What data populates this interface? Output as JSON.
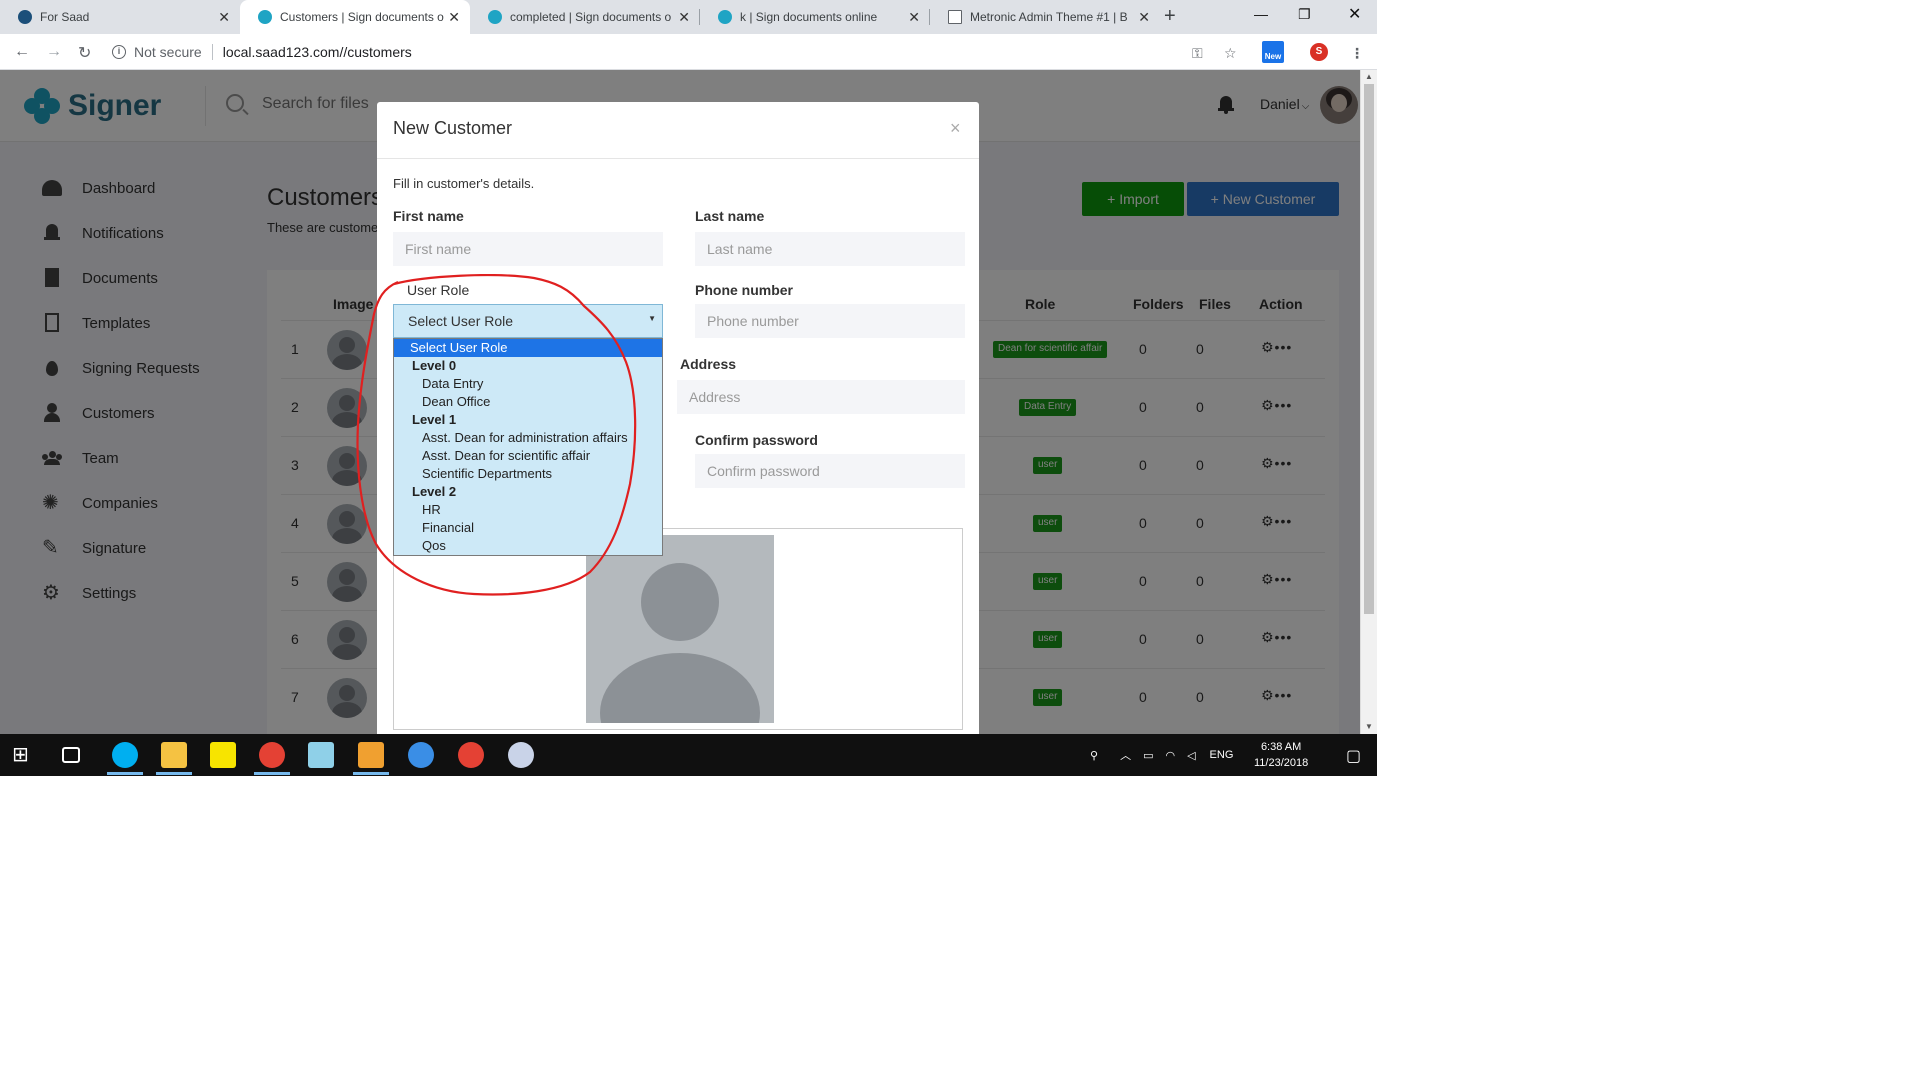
{
  "browser": {
    "tabs": [
      {
        "title": "For  Saad",
        "active": false
      },
      {
        "title": "Customers | Sign documents o",
        "active": true
      },
      {
        "title": "completed | Sign documents o",
        "active": false
      },
      {
        "title": "k | Sign documents online",
        "active": false
      },
      {
        "title": "Metronic Admin Theme #1 | B",
        "active": false
      }
    ],
    "security_label": "Not secure",
    "url": "local.saad123.com//customers",
    "extension_badge": "New",
    "profile_initial": "S"
  },
  "app": {
    "brand": "Signer",
    "search_placeholder": "Search for files a",
    "user_name": "Daniel",
    "sidebar": [
      {
        "label": "Dashboard",
        "icon": "dashboard-icon"
      },
      {
        "label": "Notifications",
        "icon": "bell-icon"
      },
      {
        "label": "Documents",
        "icon": "document-icon"
      },
      {
        "label": "Templates",
        "icon": "file-icon"
      },
      {
        "label": "Signing Requests",
        "icon": "drop-icon"
      },
      {
        "label": "Customers",
        "icon": "user-icon"
      },
      {
        "label": "Team",
        "icon": "team-icon"
      },
      {
        "label": "Companies",
        "icon": "companies-icon"
      },
      {
        "label": "Signature",
        "icon": "pen-icon"
      },
      {
        "label": "Settings",
        "icon": "gear-icon"
      }
    ],
    "page_title": "Customers",
    "page_subtitle": "These are custome",
    "import_label": "+ Import",
    "new_customer_label": "+ New Customer",
    "table": {
      "headers": [
        "Image",
        "Role",
        "Folders",
        "Files",
        "Action"
      ],
      "rows": [
        {
          "num": "1",
          "role": "Dean for scientific affair",
          "folders": "0",
          "files": "0"
        },
        {
          "num": "2",
          "role": "Data Entry",
          "folders": "0",
          "files": "0"
        },
        {
          "num": "3",
          "role": "user",
          "folders": "0",
          "files": "0"
        },
        {
          "num": "4",
          "role": "user",
          "folders": "0",
          "files": "0"
        },
        {
          "num": "5",
          "role": "user",
          "folders": "0",
          "files": "0"
        },
        {
          "num": "6",
          "role": "user",
          "folders": "0",
          "files": "0"
        },
        {
          "num": "7",
          "role": "user",
          "folders": "0",
          "files": "0"
        }
      ]
    }
  },
  "modal": {
    "title": "New Customer",
    "close": "×",
    "description": "Fill in customer's details.",
    "first_name_label": "First name",
    "first_name_placeholder": "First name",
    "last_name_label": "Last name",
    "last_name_placeholder": "Last name",
    "user_role_label": "User Role",
    "user_role_selected": "Select User Role",
    "phone_label": "Phone number",
    "phone_placeholder": "Phone number",
    "address_label": "Address",
    "address_placeholder": "Address",
    "confirm_label": "Confirm password",
    "confirm_placeholder": "Confirm password",
    "role_options": [
      {
        "text": "Select User Role",
        "kind": "selected"
      },
      {
        "text": "Level 0",
        "kind": "group"
      },
      {
        "text": "Data Entry",
        "kind": "option"
      },
      {
        "text": "Dean Office",
        "kind": "option"
      },
      {
        "text": "Level 1",
        "kind": "group"
      },
      {
        "text": "Asst. Dean for administration affairs",
        "kind": "option"
      },
      {
        "text": "Asst. Dean for scientific affair",
        "kind": "option"
      },
      {
        "text": "Scientific Departments",
        "kind": "option"
      },
      {
        "text": "Level 2",
        "kind": "group"
      },
      {
        "text": "HR",
        "kind": "option"
      },
      {
        "text": "Financial",
        "kind": "option"
      },
      {
        "text": "Qos",
        "kind": "option"
      }
    ]
  },
  "taskbar": {
    "language": "ENG",
    "time": "6:38 AM",
    "date": "11/23/2018"
  },
  "colors": {
    "selected_option": "#1e74e6",
    "dropdown_bg": "#cde9f7",
    "annotation": "#e02020",
    "role_badge": "#1a9a1a",
    "import_button": "#0c9a0c",
    "new_customer_button": "#2e75c8"
  }
}
